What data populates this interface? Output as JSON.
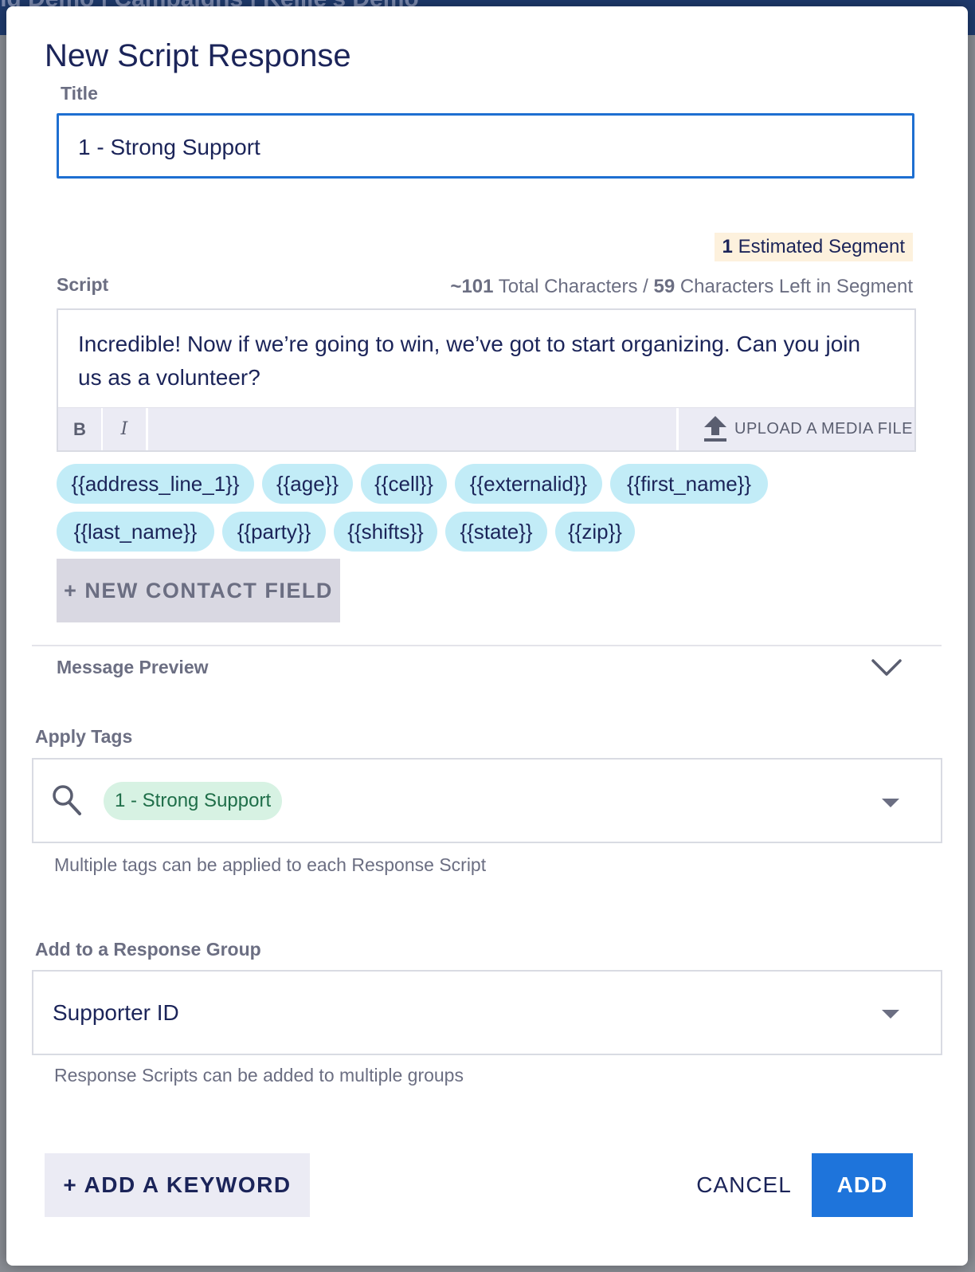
{
  "background": {
    "breadcrumb": "ng Demo  |  Campaigns  |  Kellie's Demo"
  },
  "modal": {
    "heading": "New Script Response",
    "title_field": {
      "label": "Title",
      "value": "1 - Strong Support"
    },
    "segments": {
      "count": "1",
      "label": "Estimated Segment"
    },
    "script": {
      "label": "Script",
      "total_chars": "~101",
      "total_chars_label": "Total Characters /",
      "chars_left": "59",
      "chars_left_label": "Characters Left in Segment",
      "text": "Incredible! Now if we’re going to win, we’ve got to start organizing. Can you join us as a volunteer?",
      "toolbar": {
        "bold": "B",
        "italic": "I",
        "upload": "UPLOAD A MEDIA FILE"
      }
    },
    "contact_fields": [
      "{{address_line_1}}",
      "{{age}}",
      "{{cell}}",
      "{{externalid}}",
      "{{first_name}}",
      "{{last_name}}",
      "{{party}}",
      "{{shifts}}",
      "{{state}}",
      "{{zip}}"
    ],
    "new_contact_field": "+ NEW CONTACT FIELD",
    "message_preview": "Message Preview",
    "apply_tags": {
      "label": "Apply Tags",
      "selected_tag": "1 - Strong Support",
      "help": "Multiple tags can be applied to each Response Script"
    },
    "response_group": {
      "label": "Add to a Response Group",
      "value": "Supporter ID",
      "help": "Response Scripts can be added to multiple groups"
    },
    "footer": {
      "add_keyword": "+ ADD A KEYWORD",
      "cancel": "CANCEL",
      "add": "ADD"
    }
  },
  "colors": {
    "accent": "#1e74db",
    "chip_bg": "#c2ecf7",
    "tag_bg": "#d7f2e3",
    "segment_bg": "#fdf1dd"
  },
  "icons": {
    "upload": "upload-icon",
    "search": "search-icon",
    "chevron": "chevron-down-icon",
    "dropdown": "caret-down-icon"
  }
}
